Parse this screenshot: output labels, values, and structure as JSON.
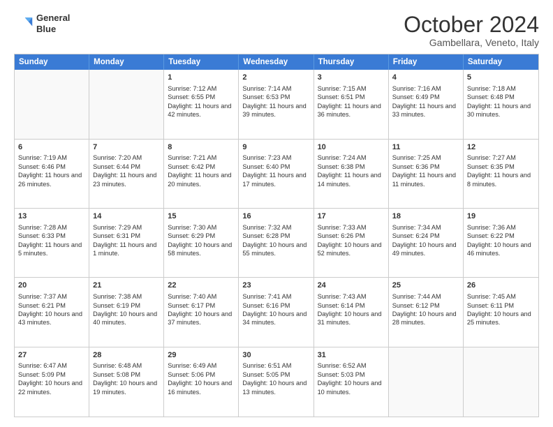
{
  "logo": {
    "line1": "General",
    "line2": "Blue"
  },
  "title": "October 2024",
  "location": "Gambellara, Veneto, Italy",
  "header_days": [
    "Sunday",
    "Monday",
    "Tuesday",
    "Wednesday",
    "Thursday",
    "Friday",
    "Saturday"
  ],
  "rows": [
    [
      {
        "day": "",
        "text": "",
        "empty": true
      },
      {
        "day": "",
        "text": "",
        "empty": true
      },
      {
        "day": "1",
        "text": "Sunrise: 7:12 AM\nSunset: 6:55 PM\nDaylight: 11 hours and 42 minutes."
      },
      {
        "day": "2",
        "text": "Sunrise: 7:14 AM\nSunset: 6:53 PM\nDaylight: 11 hours and 39 minutes."
      },
      {
        "day": "3",
        "text": "Sunrise: 7:15 AM\nSunset: 6:51 PM\nDaylight: 11 hours and 36 minutes."
      },
      {
        "day": "4",
        "text": "Sunrise: 7:16 AM\nSunset: 6:49 PM\nDaylight: 11 hours and 33 minutes."
      },
      {
        "day": "5",
        "text": "Sunrise: 7:18 AM\nSunset: 6:48 PM\nDaylight: 11 hours and 30 minutes."
      }
    ],
    [
      {
        "day": "6",
        "text": "Sunrise: 7:19 AM\nSunset: 6:46 PM\nDaylight: 11 hours and 26 minutes."
      },
      {
        "day": "7",
        "text": "Sunrise: 7:20 AM\nSunset: 6:44 PM\nDaylight: 11 hours and 23 minutes."
      },
      {
        "day": "8",
        "text": "Sunrise: 7:21 AM\nSunset: 6:42 PM\nDaylight: 11 hours and 20 minutes."
      },
      {
        "day": "9",
        "text": "Sunrise: 7:23 AM\nSunset: 6:40 PM\nDaylight: 11 hours and 17 minutes."
      },
      {
        "day": "10",
        "text": "Sunrise: 7:24 AM\nSunset: 6:38 PM\nDaylight: 11 hours and 14 minutes."
      },
      {
        "day": "11",
        "text": "Sunrise: 7:25 AM\nSunset: 6:36 PM\nDaylight: 11 hours and 11 minutes."
      },
      {
        "day": "12",
        "text": "Sunrise: 7:27 AM\nSunset: 6:35 PM\nDaylight: 11 hours and 8 minutes."
      }
    ],
    [
      {
        "day": "13",
        "text": "Sunrise: 7:28 AM\nSunset: 6:33 PM\nDaylight: 11 hours and 5 minutes."
      },
      {
        "day": "14",
        "text": "Sunrise: 7:29 AM\nSunset: 6:31 PM\nDaylight: 11 hours and 1 minute."
      },
      {
        "day": "15",
        "text": "Sunrise: 7:30 AM\nSunset: 6:29 PM\nDaylight: 10 hours and 58 minutes."
      },
      {
        "day": "16",
        "text": "Sunrise: 7:32 AM\nSunset: 6:28 PM\nDaylight: 10 hours and 55 minutes."
      },
      {
        "day": "17",
        "text": "Sunrise: 7:33 AM\nSunset: 6:26 PM\nDaylight: 10 hours and 52 minutes."
      },
      {
        "day": "18",
        "text": "Sunrise: 7:34 AM\nSunset: 6:24 PM\nDaylight: 10 hours and 49 minutes."
      },
      {
        "day": "19",
        "text": "Sunrise: 7:36 AM\nSunset: 6:22 PM\nDaylight: 10 hours and 46 minutes."
      }
    ],
    [
      {
        "day": "20",
        "text": "Sunrise: 7:37 AM\nSunset: 6:21 PM\nDaylight: 10 hours and 43 minutes."
      },
      {
        "day": "21",
        "text": "Sunrise: 7:38 AM\nSunset: 6:19 PM\nDaylight: 10 hours and 40 minutes."
      },
      {
        "day": "22",
        "text": "Sunrise: 7:40 AM\nSunset: 6:17 PM\nDaylight: 10 hours and 37 minutes."
      },
      {
        "day": "23",
        "text": "Sunrise: 7:41 AM\nSunset: 6:16 PM\nDaylight: 10 hours and 34 minutes."
      },
      {
        "day": "24",
        "text": "Sunrise: 7:43 AM\nSunset: 6:14 PM\nDaylight: 10 hours and 31 minutes."
      },
      {
        "day": "25",
        "text": "Sunrise: 7:44 AM\nSunset: 6:12 PM\nDaylight: 10 hours and 28 minutes."
      },
      {
        "day": "26",
        "text": "Sunrise: 7:45 AM\nSunset: 6:11 PM\nDaylight: 10 hours and 25 minutes."
      }
    ],
    [
      {
        "day": "27",
        "text": "Sunrise: 6:47 AM\nSunset: 5:09 PM\nDaylight: 10 hours and 22 minutes."
      },
      {
        "day": "28",
        "text": "Sunrise: 6:48 AM\nSunset: 5:08 PM\nDaylight: 10 hours and 19 minutes."
      },
      {
        "day": "29",
        "text": "Sunrise: 6:49 AM\nSunset: 5:06 PM\nDaylight: 10 hours and 16 minutes."
      },
      {
        "day": "30",
        "text": "Sunrise: 6:51 AM\nSunset: 5:05 PM\nDaylight: 10 hours and 13 minutes."
      },
      {
        "day": "31",
        "text": "Sunrise: 6:52 AM\nSunset: 5:03 PM\nDaylight: 10 hours and 10 minutes."
      },
      {
        "day": "",
        "text": "",
        "empty": true
      },
      {
        "day": "",
        "text": "",
        "empty": true
      }
    ]
  ]
}
